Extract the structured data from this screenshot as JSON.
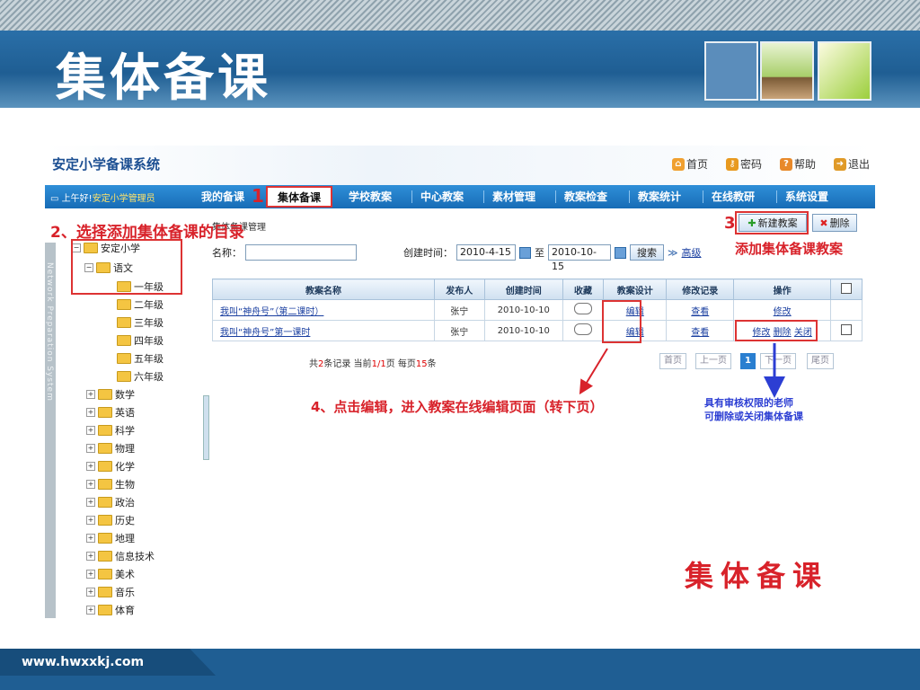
{
  "slide": {
    "title": "集体备课",
    "footer_url": "www.hwxxkj.com"
  },
  "app": {
    "name": "安定小学备课系统",
    "top_links": [
      {
        "label": "首页",
        "icon": "home-icon",
        "color": "#f0a030"
      },
      {
        "label": "密码",
        "icon": "key-icon",
        "color": "#e89a20"
      },
      {
        "label": "帮助",
        "icon": "help-icon",
        "color": "#e8892a"
      },
      {
        "label": "退出",
        "icon": "exit-icon",
        "color": "#e09a28"
      }
    ],
    "greeting_prefix": "上午好!",
    "greeting_user": "安定小学管理员",
    "nav": [
      "我的备课",
      "集体备课",
      "学校教案",
      "中心教案",
      "素材管理",
      "教案检查",
      "教案统计",
      "在线教研",
      "系统设置"
    ]
  },
  "tree": {
    "sidebar_text": "Network Preparation System",
    "root": "安定小学",
    "subject_open": "语文",
    "grades": [
      "一年级",
      "二年级",
      "三年级",
      "四年级",
      "五年级",
      "六年级"
    ],
    "subjects": [
      "数学",
      "英语",
      "科学",
      "物理",
      "化学",
      "生物",
      "政治",
      "历史",
      "地理",
      "信息技术",
      "美术",
      "音乐",
      "体育"
    ]
  },
  "main": {
    "breadcrumb": "集体备课管理",
    "new_button": "新建教案",
    "delete_button": "删除",
    "search": {
      "name_label": "名称：",
      "name_value": "",
      "date_label": "创建时间：",
      "date_from": "2010-4-15",
      "to_label": "至",
      "date_to": "2010-10-15",
      "search_button": "搜索",
      "advanced": "高级"
    },
    "table": {
      "headers": [
        "教案名称",
        "发布人",
        "创建时间",
        "收藏",
        "教案设计",
        "修改记录",
        "操作"
      ],
      "rows": [
        {
          "name": "我叫“神舟号”（第二课时）",
          "author": "张宁",
          "date": "2010-10-10",
          "design": "编辑",
          "history": "查看",
          "ops": [
            "修改"
          ]
        },
        {
          "name": "我叫“神舟号”第一课时",
          "author": "张宁",
          "date": "2010-10-10",
          "design": "编辑",
          "history": "查看",
          "ops": [
            "修改",
            "删除",
            "关闭"
          ]
        }
      ]
    },
    "pager": {
      "prefix": "共",
      "total": "2",
      "mid1": "条记录 当前",
      "current": "1",
      "slash": "/",
      "pages": "1",
      "mid2": "页 每页",
      "per_page": "15",
      "suffix": "条",
      "buttons": [
        "首页",
        "上一页",
        "1",
        "下一页",
        "尾页"
      ]
    }
  },
  "annotations": {
    "step1": "1",
    "step2": "2、选择添加集体备课的目录",
    "step3": "3",
    "step3_text": "添加集体备课教案",
    "step4": "4、点击编辑，进入教案在线编辑页面（转下页）",
    "note_line1": "具有审核权限的老师",
    "note_line2": "可删除或关闭集体备课",
    "big_label": "集体备课"
  },
  "colors": {
    "nav_blue": "#176cb6",
    "annotation_red": "#d8222a",
    "annotation_blue": "#2c3ed3"
  }
}
